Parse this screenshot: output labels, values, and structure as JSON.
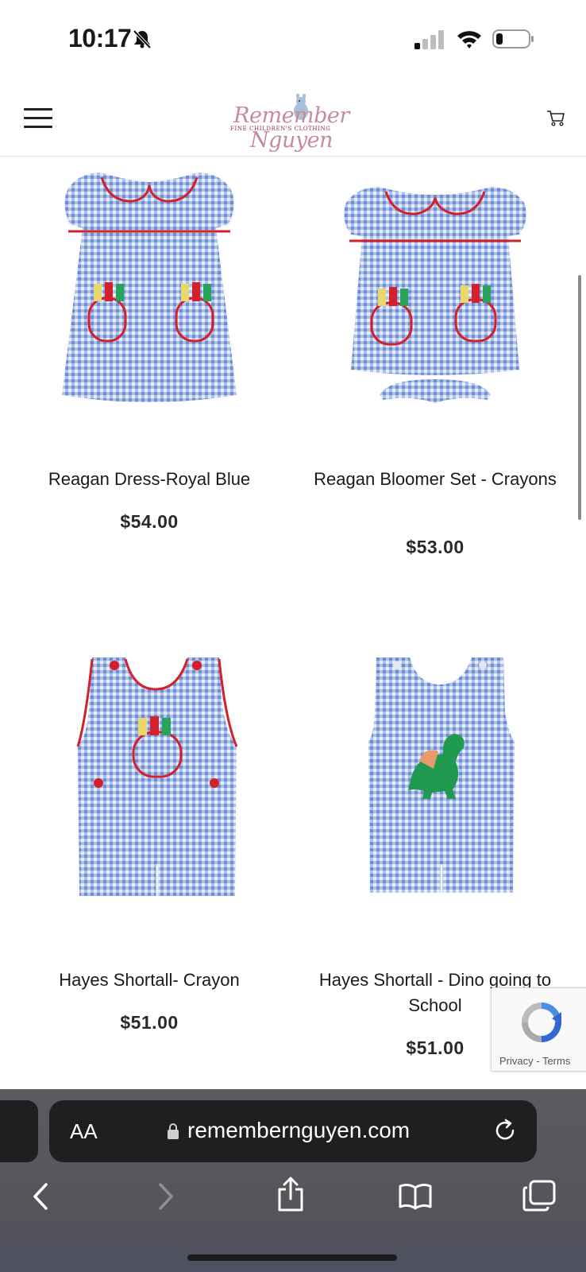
{
  "status": {
    "time": "10:17"
  },
  "site": {
    "logo_text": "Remember Nguyen",
    "logo_subtext": "FINE CHILDREN'S CLOTHING"
  },
  "products": [
    {
      "name": "Reagan Dress-Royal Blue",
      "price": "$54.00"
    },
    {
      "name": "Reagan Bloomer Set - Crayons",
      "price": "$53.00"
    },
    {
      "name": "Hayes Shortall- Crayon",
      "price": "$51.00"
    },
    {
      "name": "Hayes Shortall - Dino going to School",
      "price": "$51.00"
    }
  ],
  "recaptcha": {
    "privacy": "Privacy",
    "separator": " - ",
    "terms": "Terms"
  },
  "browser": {
    "text_size": "AA",
    "url": "remembernguyen.com"
  },
  "colors": {
    "gingham": "#8fa9e0",
    "piping": "#d4202a",
    "accent_logo": "#c98a98"
  }
}
